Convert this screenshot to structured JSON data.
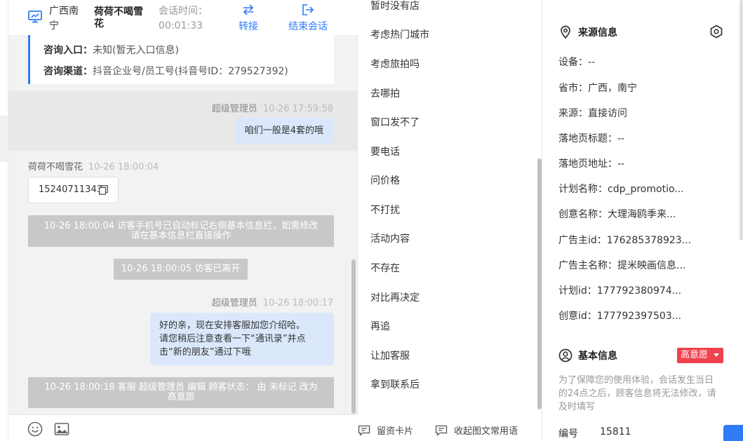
{
  "header": {
    "location": "广西南宁",
    "visitor_name": "荷荷不喝雪花",
    "session_time_label": "会话时间：",
    "session_time": "00:01:33",
    "transfer_label": "转接",
    "end_label": "结束会话"
  },
  "consult": {
    "entry_label": "咨询入口：",
    "entry_value": "未知(暂无入口信息)",
    "channel_label": "咨询渠道：",
    "channel_value": "抖音企业号/员工号(抖音号ID：279527392)"
  },
  "messages": {
    "m1_sender": "超级管理员",
    "m1_time": "10-26 17:59:58",
    "m1_text": "咱们一般是4套的哦",
    "m2_sender": "荷荷不喝雪花",
    "m2_time": "10-26 18:00:04",
    "m2_text": "15240711343",
    "sys1_line1": "10-26 18:00:04 访客手机号已自动标记右侧基本信息栏，如需修改",
    "sys1_line2": "请在基本信息栏直接操作",
    "sys2": "10-26 18:00:05 访客已离开",
    "m3_sender": "超级管理员",
    "m3_time": "10-26 18:00:17",
    "m3_line1": "好的亲，现在安排客服加您介绍哈。",
    "m3_line2": "请您稍后注意查看一下“通讯录”并点",
    "m3_line3": "击“新的朋友”通过下哦",
    "sys3_line1": "10-26 18:00:18 客服 超级管理员 编辑 顾客状态： 由 未标记 改为",
    "sys3_line2": "高意愿"
  },
  "quick_replies": [
    "暂时没有店",
    "考虑热门城市",
    "考虑旅拍吗",
    "去哪拍",
    "窗口发不了",
    "要电话",
    "问价格",
    "不打扰",
    "活动内容",
    "不存在",
    "对比再决定",
    "再追",
    "让加客服",
    "拿到联系后"
  ],
  "qr_footer": {
    "card_label": "留资卡片",
    "collapse_label": "收起图文常用语"
  },
  "source": {
    "title": "来源信息",
    "device": "设备：--",
    "province": "省市：广西，南宁",
    "origin": "来源：直接访问",
    "landing_title": "落地页标题：--",
    "landing_url": "落地页地址：--",
    "plan_name": "计划名称：cdp_promotio...",
    "creative_name": "创意名称：大理海鸥季来...",
    "advertiser_id": "广告主id：176285378923...",
    "advertiser_name": "广告主名称：提米映画信息...",
    "plan_id": "计划id：177792380974...",
    "creative_id": "创意id：177792397503..."
  },
  "basic": {
    "title": "基本信息",
    "intent_badge": "高意愿",
    "notice_line1": "为了保障您的使用体验，会话发生当日",
    "notice_line2": "的24点之后，顾客信息将无法修改，请",
    "notice_line3": "及时填写",
    "number_label": "编号",
    "number_value": "15811"
  },
  "colors": {
    "accent": "#2f7cf6",
    "badge": "#f0414e",
    "agent_bubble": "#dbe8fc",
    "system_msg": "#c8c8c8"
  }
}
